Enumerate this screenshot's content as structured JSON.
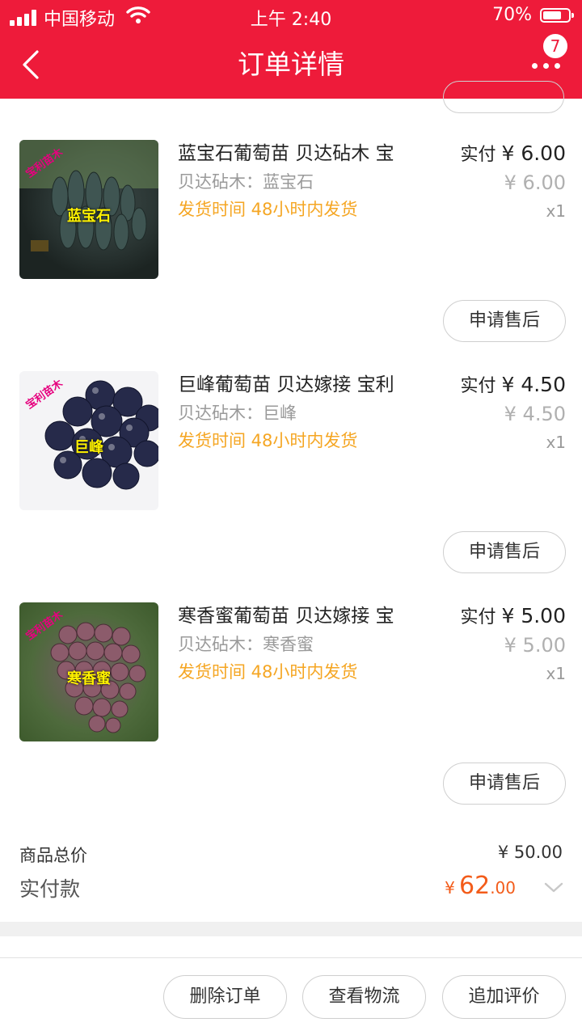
{
  "status_bar": {
    "carrier": "中国移动",
    "time": "上午 2:40",
    "battery": "70%",
    "battery_level": 0.7
  },
  "header": {
    "title": "订单详情",
    "badge_count": "7",
    "background_color": "#ee1b3a"
  },
  "items": [
    {
      "name": "蓝宝石葡萄苗  贝达砧木  宝",
      "spec": "贝达砧木：蓝宝石",
      "ship": "发货时间  48小时内发货",
      "paid_label": "实付",
      "paid_price": "¥ 6.00",
      "original_price": "¥ 6.00",
      "quantity": "x1",
      "image_label": "蓝宝石",
      "image_watermark": "宝利苗木",
      "after_sale_label": "申请售后"
    },
    {
      "name": "巨峰葡萄苗  贝达嫁接  宝利",
      "spec": "贝达砧木：巨峰",
      "ship": "发货时间  48小时内发货",
      "paid_label": "实付",
      "paid_price": "¥ 4.50",
      "original_price": "¥ 4.50",
      "quantity": "x1",
      "image_label": "巨峰",
      "image_watermark": "宝利苗木",
      "after_sale_label": "申请售后"
    },
    {
      "name": "寒香蜜葡萄苗  贝达嫁接  宝",
      "spec": "贝达砧木：寒香蜜",
      "ship": "发货时间  48小时内发货",
      "paid_label": "实付",
      "paid_price": "¥ 5.00",
      "original_price": "¥ 5.00",
      "quantity": "x1",
      "image_label": "寒香蜜",
      "image_watermark": "宝利苗木",
      "after_sale_label": "申请售后"
    }
  ],
  "totals": {
    "goods_total_label": "商品总价",
    "goods_total_value": "¥ 50.00",
    "paid_label": "实付款",
    "paid_symbol": "¥",
    "paid_integer": "62",
    "paid_decimal": ".00",
    "accent_color": "#f35c1a"
  },
  "actions": {
    "delete_label": "删除订单",
    "logistics_label": "查看物流",
    "review_label": "追加评价"
  }
}
